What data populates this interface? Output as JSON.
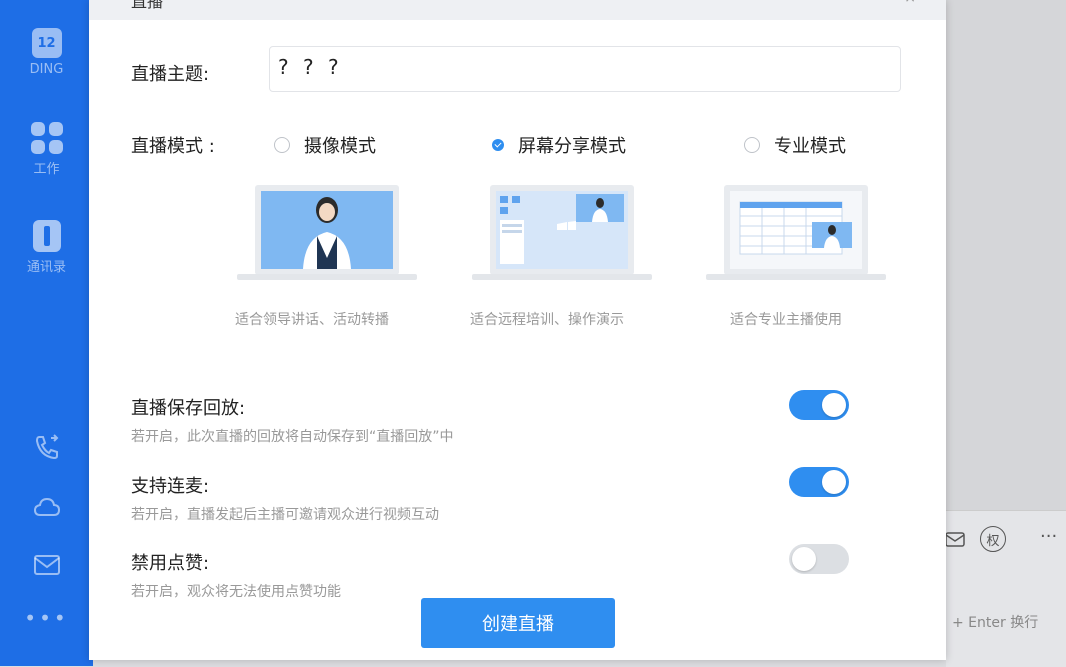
{
  "sidebar": {
    "items": [
      {
        "label": "DING",
        "badge": "12",
        "icon": "calendar-icon"
      },
      {
        "label": "工作",
        "icon": "workbench-grid-icon"
      },
      {
        "label": "通讯录",
        "icon": "contacts-icon"
      }
    ],
    "bottom_icons": [
      "phone-icon",
      "cloud-icon",
      "mail-icon",
      "more-icon"
    ],
    "more_label": "•••"
  },
  "dialog": {
    "title": "直播",
    "tab": "",
    "close_label": "×",
    "topic_label": "直播主题:",
    "topic_value": "? ? ?",
    "mode_label": "直播模式 :",
    "modes": [
      {
        "label": "摄像模式",
        "desc": "适合领导讲话、活动转播",
        "checked": false
      },
      {
        "label": "屏幕分享模式",
        "desc": "适合远程培训、操作演示",
        "checked": true
      },
      {
        "label": "专业模式",
        "desc": "适合专业主播使用",
        "checked": false
      }
    ],
    "settings": [
      {
        "label": "直播保存回放:",
        "desc": "若开启，此次直播的回放将自动保存到“直播回放”中",
        "on": true
      },
      {
        "label": "支持连麦:",
        "desc": "若开启，直播发起后主播可邀请观众进行视频互动",
        "on": true
      },
      {
        "label": "禁用点赞:",
        "desc": "若开启，观众将无法使用点赞功能",
        "on": false
      }
    ],
    "create_button": "创建直播"
  },
  "background": {
    "enter_hint": "+ Enter 换行",
    "badge_char": "权",
    "more_label": "···"
  },
  "colors": {
    "sidebar": "#1e6ee6",
    "accent": "#2f8ef0",
    "toggle_off": "#dcdfe3"
  }
}
